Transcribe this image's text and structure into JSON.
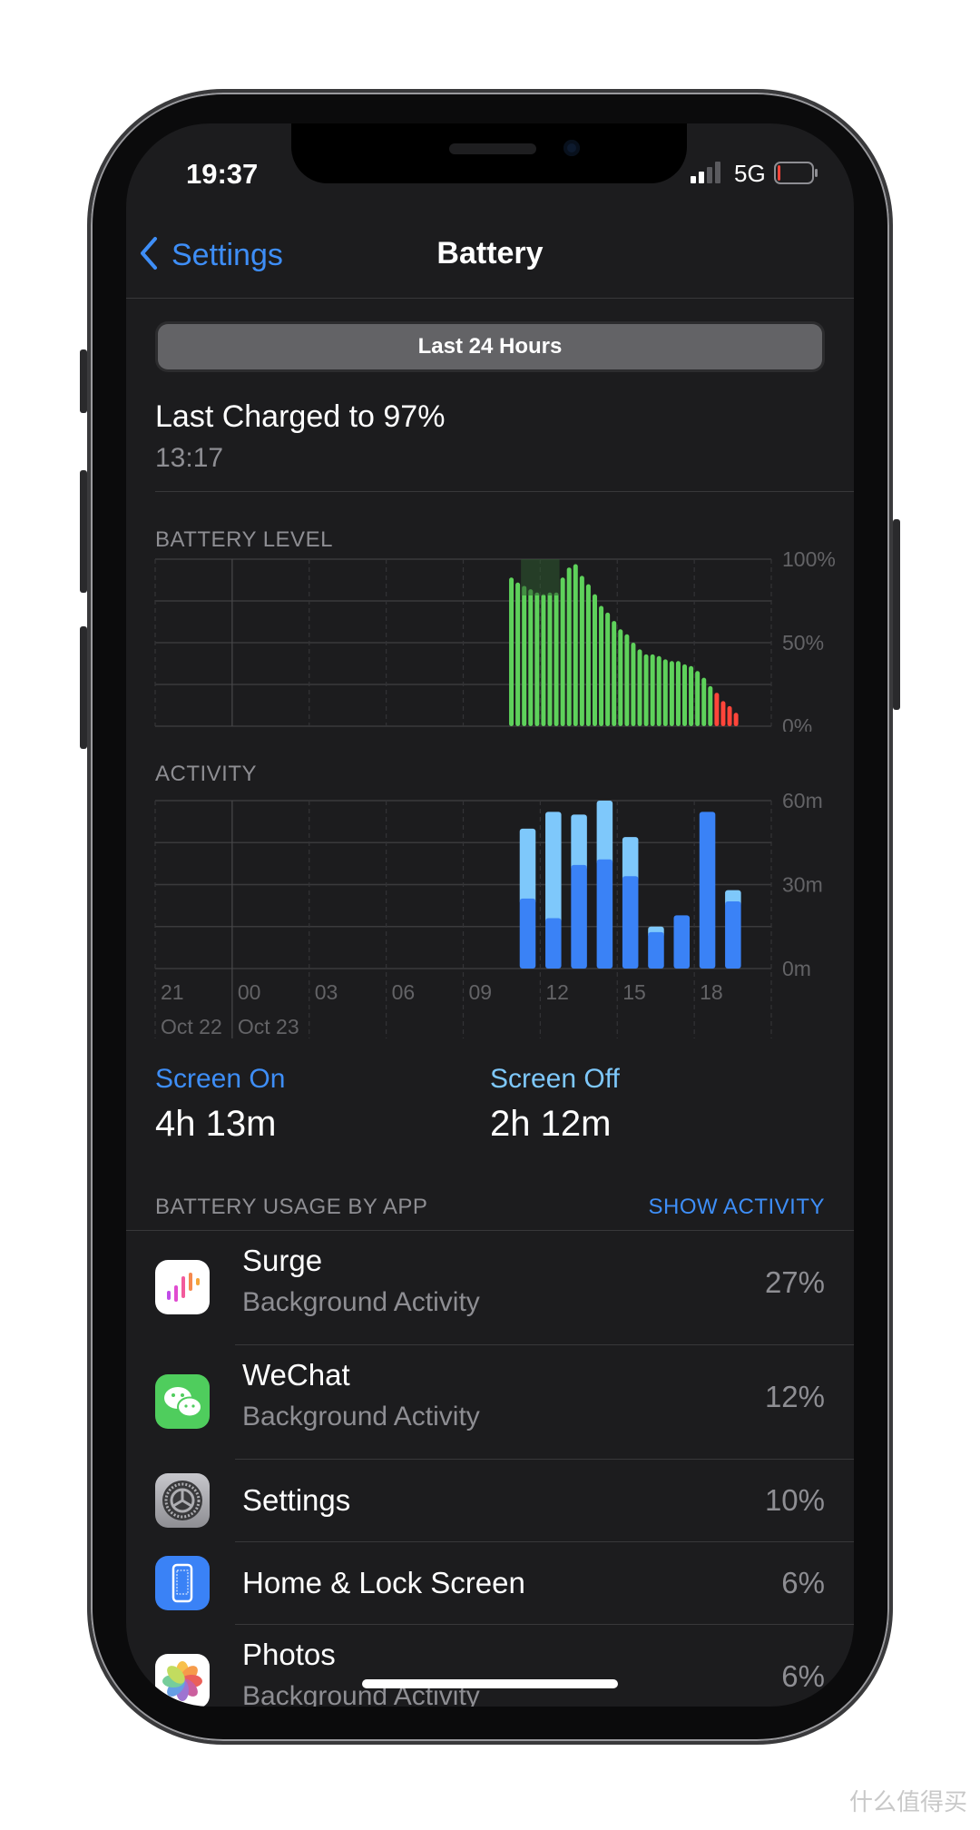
{
  "status_bar": {
    "time": "19:37",
    "network": "5G",
    "signal_bars": 2,
    "battery_level_percent": 8,
    "battery_color": "#ff453a"
  },
  "nav": {
    "back_label": "Settings",
    "title": "Battery"
  },
  "segmented": {
    "selected": "Last 24 Hours"
  },
  "last_charged": {
    "title": "Last Charged to 97%",
    "time": "13:17"
  },
  "colors": {
    "accent": "#3e8ef7",
    "battery_bar": "#5ed15b",
    "battery_low": "#ff453a",
    "screen_on": "#3a82f6",
    "screen_off": "#7ec8fb"
  },
  "chart_data": [
    {
      "type": "bar",
      "title": "BATTERY LEVEL",
      "ylim": [
        0,
        100
      ],
      "y_ticks": [
        "100%",
        "50%",
        "0%"
      ],
      "x_ticks": [
        "21",
        "00",
        "03",
        "06",
        "09",
        "12",
        "15",
        "18"
      ],
      "x_dates": [
        "Oct 22",
        "Oct 23"
      ],
      "interval_minutes": 15,
      "start": "10:45",
      "values": [
        89,
        86,
        84,
        82,
        80,
        79,
        80,
        80,
        89,
        95,
        97,
        90,
        85,
        79,
        72,
        68,
        63,
        58,
        55,
        50,
        46,
        43,
        43,
        42,
        40,
        39,
        39,
        37,
        36,
        33,
        29,
        24,
        20,
        15,
        12,
        8
      ],
      "low_threshold": 20,
      "charging_intervals": [
        "11:15-12:45"
      ],
      "grid": true
    },
    {
      "type": "bar",
      "title": "ACTIVITY",
      "ylim": [
        0,
        60
      ],
      "y_ticks": [
        "60m",
        "30m",
        "0m"
      ],
      "x_ticks": [
        "21",
        "00",
        "03",
        "06",
        "09",
        "12",
        "15",
        "18"
      ],
      "x_dates": [
        "Oct 22",
        "Oct 23"
      ],
      "categories": [
        "11",
        "12",
        "13",
        "14",
        "15",
        "16",
        "17",
        "18",
        "19"
      ],
      "stacked": true,
      "series": [
        {
          "name": "Screen On",
          "values": [
            25,
            18,
            37,
            39,
            33,
            13,
            19,
            56,
            24
          ]
        },
        {
          "name": "Screen Off",
          "values": [
            25,
            38,
            18,
            21,
            14,
            2,
            0,
            0,
            4
          ]
        }
      ],
      "grid": true
    }
  ],
  "summary": [
    {
      "label": "Screen On",
      "value": "4h 13m"
    },
    {
      "label": "Screen Off",
      "value": "2h 12m"
    }
  ],
  "usage": {
    "header": "BATTERY USAGE BY APP",
    "action": "SHOW ACTIVITY",
    "apps": [
      {
        "name": "Surge",
        "detail": "Background Activity",
        "percent": "27%",
        "icon": "surge-icon"
      },
      {
        "name": "WeChat",
        "detail": "Background Activity",
        "percent": "12%",
        "icon": "wechat-icon"
      },
      {
        "name": "Settings",
        "detail": "",
        "percent": "10%",
        "icon": "settings-gear-icon"
      },
      {
        "name": "Home & Lock Screen",
        "detail": "",
        "percent": "6%",
        "icon": "home-lock-screen-icon"
      },
      {
        "name": "Photos",
        "detail": "Background Activity",
        "percent": "6%",
        "icon": "photos-icon"
      }
    ]
  },
  "watermark": "什么值得买"
}
